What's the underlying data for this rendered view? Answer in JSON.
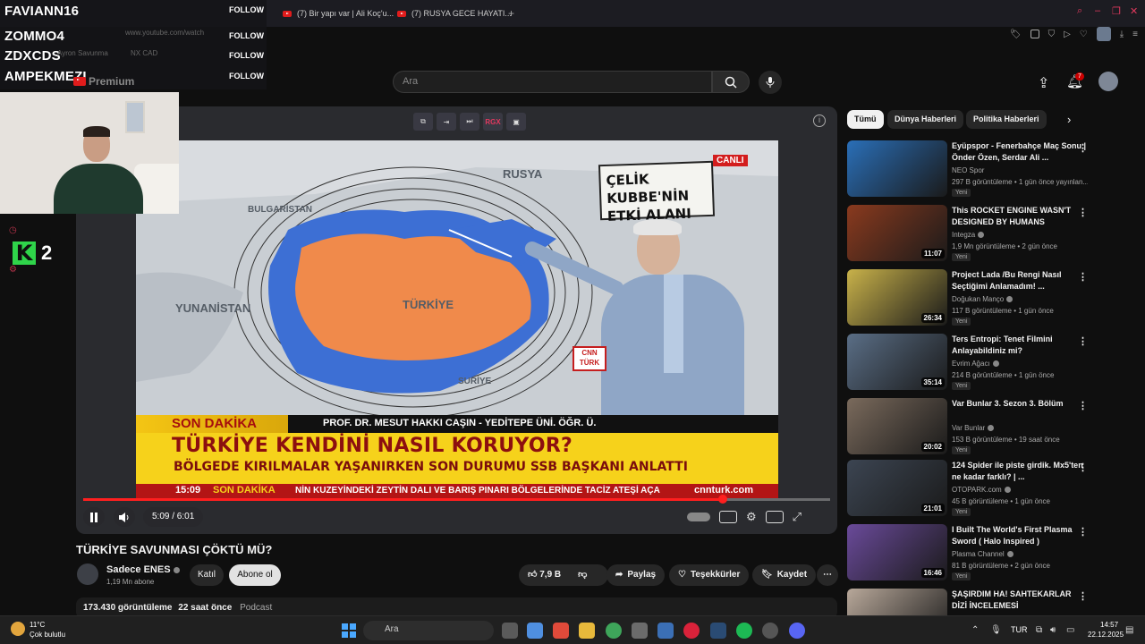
{
  "browser": {
    "tabs": [
      {
        "label": "(7) Bir yapı var | Ali Koç'u..."
      },
      {
        "label": "(7) RUSYA GECE HAYATI..."
      }
    ],
    "address_ghost": "www.youtube.com/watch",
    "ghost_bookmarks": [
      "Ayron Savunma",
      "NX CAD"
    ],
    "accent_color": "#e2395e"
  },
  "stream_overlay": {
    "followers": [
      {
        "name": "FAVIANN16",
        "tag": "FOLLOW"
      },
      {
        "name": "ZOMMO4",
        "tag": "FOLLOW"
      },
      {
        "name": "ZDXCDS",
        "tag": "FOLLOW"
      },
      {
        "name": "AMPEKMEZI",
        "tag": "FOLLOW"
      }
    ],
    "logo_letter": "K",
    "logo_number": "2",
    "logo_color": "#2fd44a"
  },
  "youtube_header": {
    "premium_label": "Premium",
    "search_placeholder": "Ara",
    "notification_count": "7"
  },
  "player": {
    "current_time": "5:09",
    "duration": "6:01",
    "time_display": "5:09 / 6:01",
    "progress_fraction": 0.856,
    "top_control_active": "RGX"
  },
  "frame": {
    "live_badge": "CANLI",
    "effect_card": [
      "ÇELİK KUBBE'NİN",
      "ETKİ ALANI"
    ],
    "map_labels": [
      "RUSYA",
      "BULGARİSTAN",
      "TÜRKİYE",
      "YUNANİSTAN",
      "SURİYE"
    ],
    "mic_label": "CNN TÜRK",
    "breaking_label": "SON DAKİKA",
    "guest_line": "PROF. DR. MESUT HAKKI CAŞIN - YEDİTEPE ÜNİ. ÖĞR. Ü.",
    "headline": "TÜRKİYE KENDİNİ NASIL KORUYOR?",
    "subheadline": "BÖLGEDE KIRILMALAR YAŞANIRKEN SON DURUMU SSB BAŞKANI ANLATTI",
    "ticker_time": "15:09",
    "ticker_tag": "SON DAKİKA",
    "ticker_text": "NİN KUZEYİNDEKİ ZEYTİN DALI VE BARIŞ PINARI BÖLGELERİNDE TACİZ ATEŞİ AÇA",
    "ticker_site": "cnnturk.com"
  },
  "video": {
    "title": "TÜRKİYE SAVUNMASI ÇÖKTÜ MÜ?",
    "channel_name": "Sadece ENES",
    "subscribers": "1,19 Mn abone",
    "join_label": "Katıl",
    "subscribe_label": "Abone ol",
    "likes": "7,9 B",
    "share_label": "Paylaş",
    "thanks_label": "Teşekkürler",
    "save_label": "Kaydet",
    "views": "173.430 görüntüleme",
    "age": "22 saat önce",
    "tag": "Podcast"
  },
  "sidebar": {
    "chips": [
      "Tümü",
      "Dünya Haberleri",
      "Politika Haberleri"
    ],
    "recommendations": [
      {
        "title": "Eyüpspor - Fenerbahçe Maç Sonu | Önder Özen, Serdar Ali ...",
        "channel": "NEO Spor",
        "meta": "297 B görüntüleme • 1 gün önce yayınlan...",
        "badge": "Yeni",
        "duration": "",
        "thumb_color": "#2a6fb8",
        "verified": false
      },
      {
        "title": "This ROCKET ENGINE WASN'T DESIGNED BY HUMANS",
        "channel": "Integza",
        "meta": "1,9 Mn görüntüleme • 2 gün önce",
        "badge": "Yeni",
        "duration": "11:07",
        "thumb_color": "#8a3a1e",
        "verified": true
      },
      {
        "title": "Project Lada /Bu Rengi Nasıl Seçtiğimi Anlamadım! ...",
        "channel": "Doğukan Manço",
        "meta": "117 B görüntüleme • 1 gün önce",
        "badge": "Yeni",
        "duration": "26:34",
        "thumb_color": "#c9b24a",
        "verified": true
      },
      {
        "title": "Ters Entropi: Tenet Filmini Anlayabildiniz mi?",
        "channel": "Evrim Ağacı",
        "meta": "214 B görüntüleme • 1 gün önce",
        "badge": "Yeni",
        "duration": "35:14",
        "thumb_color": "#5a6e86",
        "verified": true
      },
      {
        "title": "Var Bunlar 3. Sezon 3. Bölüm",
        "channel": "Var Bunlar",
        "meta": "153 B görüntüleme • 19 saat önce",
        "badge": "Yeni",
        "duration": "20:02",
        "thumb_color": "#7a6a5c",
        "verified": true
      },
      {
        "title": "124 Spider ile piste girdik. Mx5'ten ne kadar farklı? | ...",
        "channel": "OTOPARK.com",
        "meta": "45 B görüntüleme • 1 gün önce",
        "badge": "Yeni",
        "duration": "21:01",
        "thumb_color": "#3c4552",
        "verified": true
      },
      {
        "title": "I Built The World's First Plasma Sword ( Halo Inspired )",
        "channel": "Plasma Channel",
        "meta": "81 B görüntüleme • 2 gün önce",
        "badge": "Yeni",
        "duration": "16:46",
        "thumb_color": "#6a4a9a",
        "verified": true
      },
      {
        "title": "ŞAŞIRDIM HA! SAHTEKARLAR DİZİ İNCELEMESİ",
        "channel": "",
        "meta": "",
        "badge": "",
        "duration": "",
        "thumb_color": "#b8a89a",
        "verified": false
      }
    ]
  },
  "taskbar": {
    "weather_temp": "11°C",
    "weather_desc": "Çok bulutlu",
    "search_label": "Ara",
    "language": "TUR",
    "time": "14:57",
    "date": "22.12.2025"
  }
}
